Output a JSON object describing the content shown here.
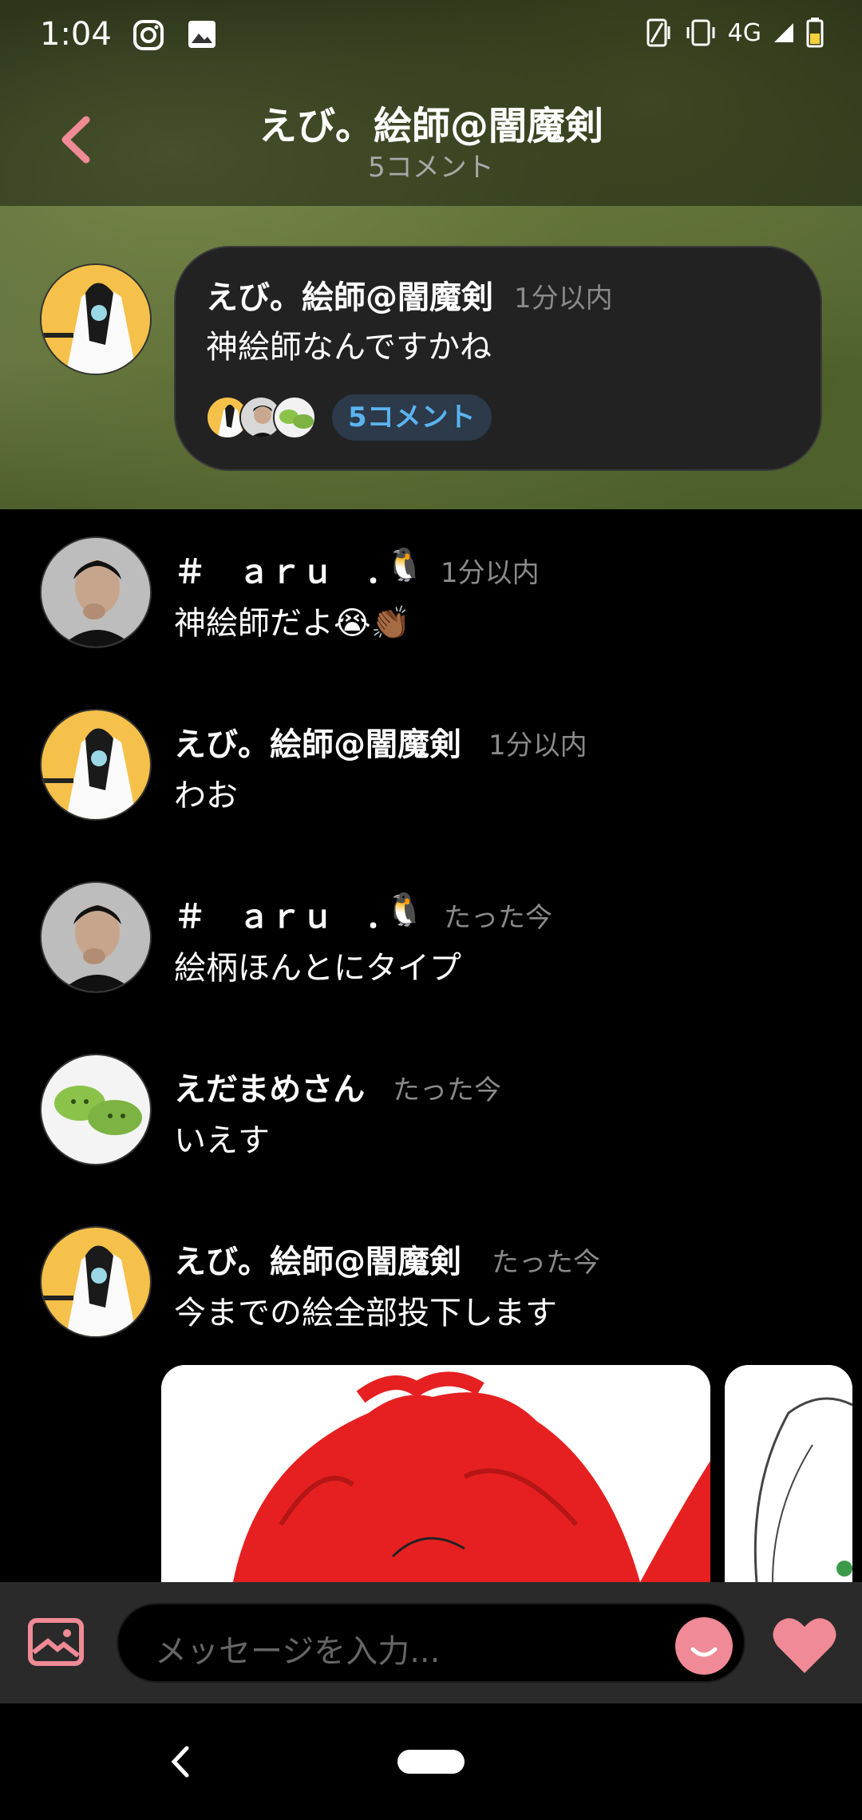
{
  "status_bar": {
    "time": "1:04",
    "network": "4G"
  },
  "header": {
    "title": "えび。絵師@闇魔剣",
    "subtitle": "5コメント"
  },
  "parent_comment": {
    "name": "えび。絵師@闇魔剣",
    "time": "1分以内",
    "text": "神絵師なんですかね",
    "reply_badge": "5コメント"
  },
  "comments": [
    {
      "name": "＃　ａｒｕ　．",
      "time": "1分以内",
      "text": "神絵師だよ😭👏🏾",
      "avatar": "man"
    },
    {
      "name": "えび。絵師@闇魔剣",
      "time": "1分以内",
      "text": "わお",
      "avatar": "anime"
    },
    {
      "name": "＃　ａｒｕ　．",
      "time": "たった今",
      "text": "絵柄ほんとにタイプ",
      "avatar": "man"
    },
    {
      "name": "えだまめさん",
      "time": "たった今",
      "text": "いえす",
      "avatar": "edamame"
    },
    {
      "name": "えび。絵師@闇魔剣",
      "time": "たった今",
      "text": "今までの絵全部投下します",
      "avatar": "anime"
    }
  ],
  "input": {
    "placeholder": "メッセージを入力..."
  },
  "colors": {
    "accent": "#f08a96",
    "badge_text": "#5bb3f0"
  }
}
